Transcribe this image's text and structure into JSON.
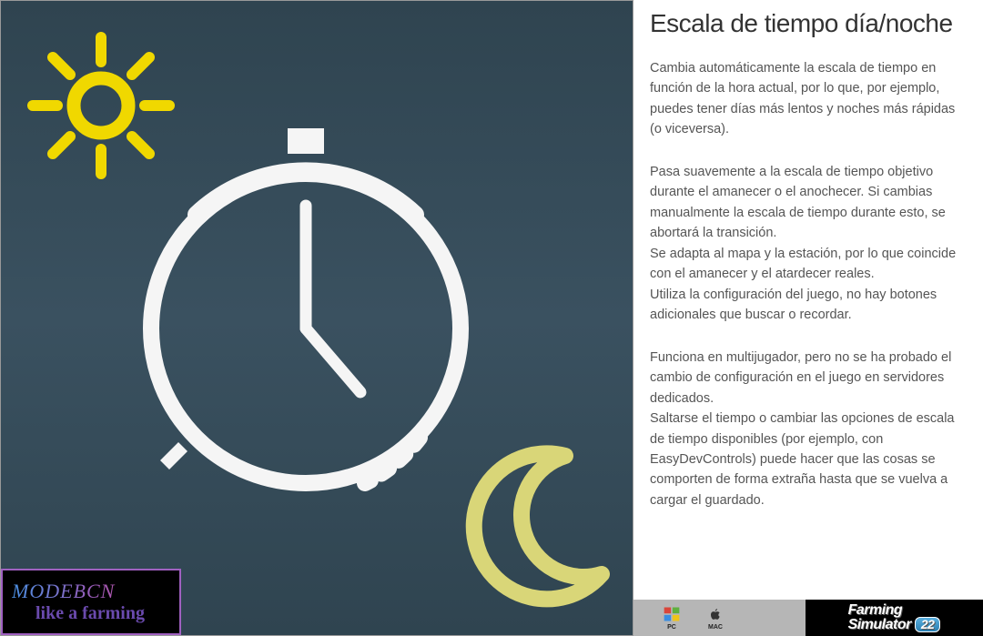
{
  "article": {
    "title": "Escala de tiempo día/noche",
    "p1": "Cambia automáticamente la escala de tiempo en función de la hora actual, por lo que, por ejemplo, puedes tener días más lentos y noches más rápidas (o viceversa).",
    "p2": "Pasa suavemente a la escala de tiempo objetivo durante el amanecer o el anochecer. Si cambias manualmente la escala de tiempo durante esto, se abortará la transición.",
    "p3": "Se adapta al mapa y la estación, por lo que coincide con el amanecer y el atardecer reales.",
    "p4": "Utiliza la configuración del juego, no hay botones adicionales que buscar o recordar.",
    "p5": "Funciona en multijugador, pero no se ha probado el cambio de configuración en el juego en servidores dedicados.",
    "p6": "Saltarse el tiempo o cambiar las opciones de escala de tiempo disponibles (por ejemplo, con EasyDevControls) puede hacer que las cosas se comporten de forma extraña hasta que se vuelva a cargar el guardado."
  },
  "platforms": {
    "pc_label": "PC",
    "mac_label": "MAC"
  },
  "game_badge": {
    "line1": "Farming",
    "line2": "Simulator",
    "num": "22"
  },
  "source_badge": {
    "line1": "MODEBCN",
    "line2": "like a farming"
  },
  "icons": {
    "sun": "sun-icon",
    "moon": "moon-icon",
    "clock": "clock-icon",
    "windows": "windows-icon",
    "apple": "apple-icon"
  }
}
